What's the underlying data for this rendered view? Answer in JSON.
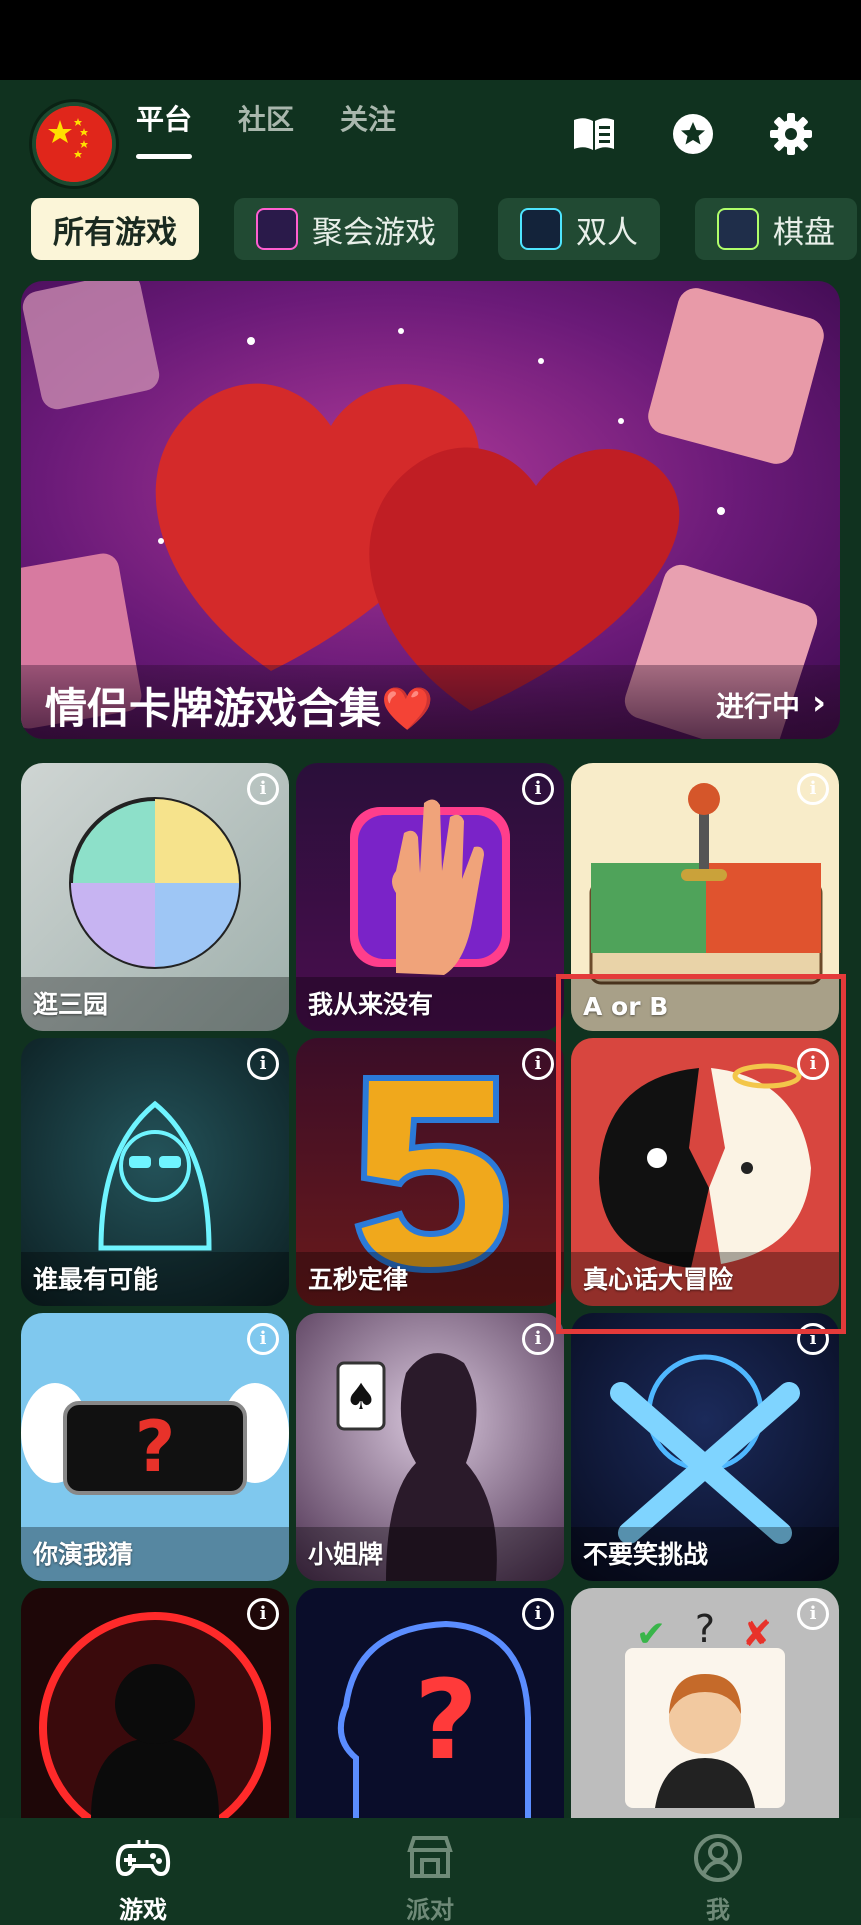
{
  "header": {
    "tabs": [
      {
        "label": "平台",
        "active": true
      },
      {
        "label": "社区",
        "active": false
      },
      {
        "label": "关注",
        "active": false
      }
    ],
    "icons": [
      "flag-china-avatar",
      "book-icon",
      "star-badge-icon",
      "gear-icon"
    ]
  },
  "categories": [
    {
      "label": "所有游戏",
      "active": true
    },
    {
      "label": "聚会游戏",
      "icon": "cheers-icon"
    },
    {
      "label": "双人",
      "icon": "crossed-swords-icon"
    },
    {
      "label": "棋盘",
      "icon": "board-game-icon"
    }
  ],
  "banner": {
    "title": "情侣卡牌游戏合集❤️",
    "status": "进行中"
  },
  "games": [
    {
      "label": "逛三园"
    },
    {
      "label": "我从来没有"
    },
    {
      "label": "A or B"
    },
    {
      "label": "谁最有可能"
    },
    {
      "label": "五秒定律"
    },
    {
      "label": "真心话大冒险"
    },
    {
      "label": "你演我猜"
    },
    {
      "label": "小姐牌"
    },
    {
      "label": "不要笑挑战"
    },
    {
      "label": ""
    },
    {
      "label": ""
    },
    {
      "label": ""
    }
  ],
  "info_glyph": "i",
  "bottom_nav": [
    {
      "label": "游戏",
      "active": true
    },
    {
      "label": "派对",
      "active": false
    },
    {
      "label": "我",
      "active": false
    }
  ],
  "colors": {
    "background": "#10321f",
    "chip_active": "#fbf5d8",
    "highlight_box": "#e43a3a"
  }
}
